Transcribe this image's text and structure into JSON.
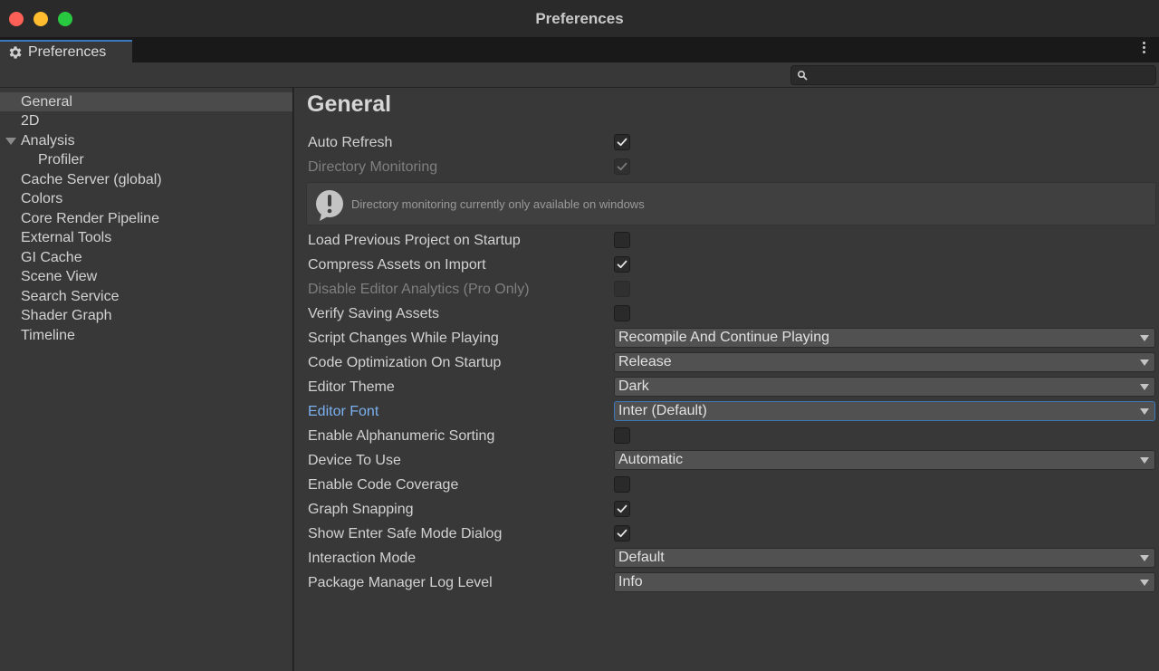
{
  "window": {
    "title": "Preferences"
  },
  "tab": {
    "label": "Preferences"
  },
  "search": {
    "placeholder": "",
    "value": ""
  },
  "sidebar": {
    "items": [
      {
        "label": "General"
      },
      {
        "label": "2D"
      },
      {
        "label": "Analysis"
      },
      {
        "label": "Profiler"
      },
      {
        "label": "Cache Server (global)"
      },
      {
        "label": "Colors"
      },
      {
        "label": "Core Render Pipeline"
      },
      {
        "label": "External Tools"
      },
      {
        "label": "GI Cache"
      },
      {
        "label": "Scene View"
      },
      {
        "label": "Search Service"
      },
      {
        "label": "Shader Graph"
      },
      {
        "label": "Timeline"
      }
    ]
  },
  "content": {
    "title": "General",
    "auto_refresh": {
      "label": "Auto Refresh",
      "checked": true
    },
    "directory_monitoring": {
      "label": "Directory Monitoring",
      "checked": true
    },
    "help_message": "Directory monitoring currently only available on windows",
    "load_previous_project": {
      "label": "Load Previous Project on Startup",
      "checked": false
    },
    "compress_assets": {
      "label": "Compress Assets on Import",
      "checked": true
    },
    "disable_analytics": {
      "label": "Disable Editor Analytics (Pro Only)",
      "checked": false
    },
    "verify_saving": {
      "label": "Verify Saving Assets",
      "checked": false
    },
    "script_changes": {
      "label": "Script Changes While Playing",
      "value": "Recompile And Continue Playing"
    },
    "code_optimization": {
      "label": "Code Optimization On Startup",
      "value": "Release"
    },
    "editor_theme": {
      "label": "Editor Theme",
      "value": "Dark"
    },
    "editor_font": {
      "label": "Editor Font",
      "value": "Inter (Default)"
    },
    "alphanumeric_sorting": {
      "label": "Enable Alphanumeric Sorting",
      "checked": false
    },
    "device_to_use": {
      "label": "Device To Use",
      "value": "Automatic"
    },
    "code_coverage": {
      "label": "Enable Code Coverage",
      "checked": false
    },
    "graph_snapping": {
      "label": "Graph Snapping",
      "checked": true
    },
    "safe_mode_dialog": {
      "label": "Show Enter Safe Mode Dialog",
      "checked": true
    },
    "interaction_mode": {
      "label": "Interaction Mode",
      "value": "Default"
    },
    "package_log_level": {
      "label": "Package Manager Log Level",
      "value": "Info"
    }
  },
  "colors": {
    "accent": "#3a79bb",
    "focused_label": "#7bb1f0",
    "close": "#fe5f57",
    "minimize": "#febc2e",
    "maximize": "#28c840"
  }
}
